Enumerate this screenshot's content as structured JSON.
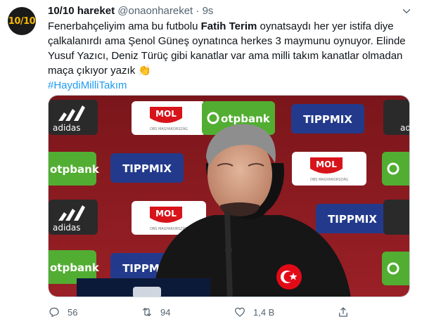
{
  "tweet": {
    "author_name": "10/10 hareket",
    "handle": "@onaonhareket",
    "separator": "·",
    "time": "9s",
    "avatar_text": "10/10",
    "text_parts": {
      "p1": "Fenerbahçeliyim ama bu futbolu ",
      "b1": "Fatih Terim",
      "p2": " oynatsaydı her yer istifa diye çalkalanırdı ama Şenol Güneş oynatınca herkes 3 maymunu oynuyor. Elinde Yusuf Yazıcı, Deniz Türüç gibi kanatlar var ama milli takım kanatlar olmadan maça çıkıyor yazık ",
      "emoji": "👏"
    },
    "hashtag": "#HaydiMilliTakım"
  },
  "media": {
    "sponsors": {
      "adidas": "adidas",
      "mol": "MOL",
      "mol_sub": "OBS MAGYARORSZÁG",
      "otpbank": "otpbank",
      "tippmix": "TIPPMIX"
    },
    "colors": {
      "board": "#8c1d22",
      "otp_green": "#52ae32",
      "tippmix_blue": "#233a8c",
      "mol_red": "#d7141a",
      "jacket": "#161616",
      "flag_red": "#e30a17"
    }
  },
  "actions": {
    "reply_count": "56",
    "retweet_count": "94",
    "like_count": "1,4 B"
  },
  "icons": {
    "more": "more-icon",
    "reply": "reply-icon",
    "retweet": "retweet-icon",
    "like": "like-icon",
    "share": "share-icon"
  }
}
